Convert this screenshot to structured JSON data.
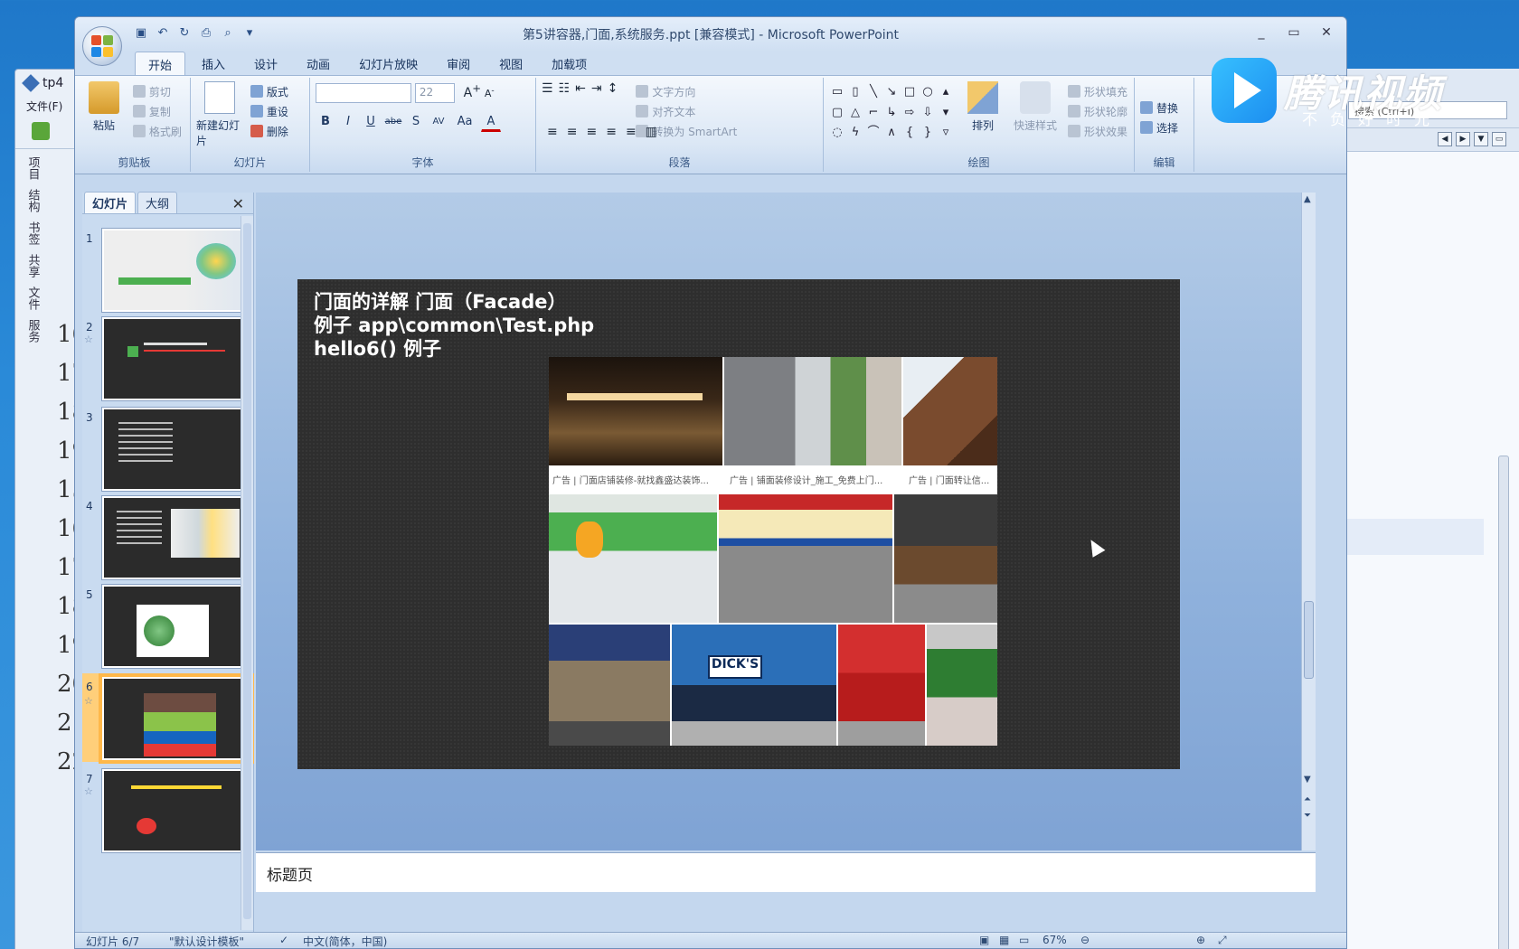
{
  "bg_app": {
    "title": "tp4",
    "menu": "文件(F)",
    "side_labels": [
      "项目",
      "结构",
      "书签",
      "共享",
      "文件",
      "服务"
    ],
    "line_numbers": [
      "16",
      "17",
      "18",
      "19",
      "15",
      "16",
      "17",
      "18",
      "19",
      "20",
      "21",
      "22"
    ]
  },
  "bg_right": {
    "search_placeholder": "搜索 (Ctrl+I)"
  },
  "window": {
    "title": "第5讲容器,门面,系统服务.ppt [兼容模式] - Microsoft PowerPoint",
    "min": "_",
    "max": "▭",
    "close": "✕"
  },
  "tabs": [
    "开始",
    "插入",
    "设计",
    "动画",
    "幻灯片放映",
    "审阅",
    "视图",
    "加载项"
  ],
  "ribbon": {
    "clipboard": {
      "label": "剪贴板",
      "paste": "粘贴",
      "cut": "剪切",
      "copy": "复制",
      "painter": "格式刷"
    },
    "slides": {
      "label": "幻灯片",
      "new_slide": "新建幻灯片",
      "layout": "版式",
      "reset": "重设",
      "delete": "删除"
    },
    "font": {
      "label": "字体",
      "size": "22",
      "buttons": [
        "B",
        "I",
        "U",
        "abe",
        "S",
        "AV",
        "Aa",
        "A"
      ]
    },
    "paragraph": {
      "label": "段落",
      "text_dir": "文字方向",
      "align_text": "对齐文本",
      "smartart": "转换为 SmartArt"
    },
    "drawing": {
      "label": "绘图",
      "arrange": "排列",
      "quick_styles": "快速样式",
      "fill": "形状填充",
      "outline": "形状轮廓",
      "effects": "形状效果"
    },
    "editing": {
      "label": "编辑",
      "replace": "替换",
      "select": "选择"
    }
  },
  "watermark": {
    "brand": "腾讯视频",
    "slogan": "不负好时光"
  },
  "panel": {
    "tab_slides": "幻灯片",
    "tab_outline": "大纲",
    "slide_numbers": [
      "1",
      "2",
      "3",
      "4",
      "5",
      "6",
      "7"
    ],
    "selected_index": 6
  },
  "slide": {
    "line1": "门面的详解 门面（Facade）",
    "line2": "例子 app\\common\\Test.php",
    "line3": "hello6() 例子",
    "captions": [
      "广告 | 门面店铺装修-就找鑫盛达装饰...",
      "广告 | 铺面装修设计_施工_免费上门...",
      "广告 | 门面转让信..."
    ]
  },
  "notes": {
    "text": "标题页"
  },
  "status": {
    "slide_info": "幻灯片 6/7",
    "theme": "\"默认设计模板\"",
    "language": "中文(简体，中国)",
    "zoom": "67%"
  },
  "colors": {
    "accent": "#ffb84a",
    "slide_bg": "#2e2e2e",
    "ribbon": "#dbe7f5"
  }
}
